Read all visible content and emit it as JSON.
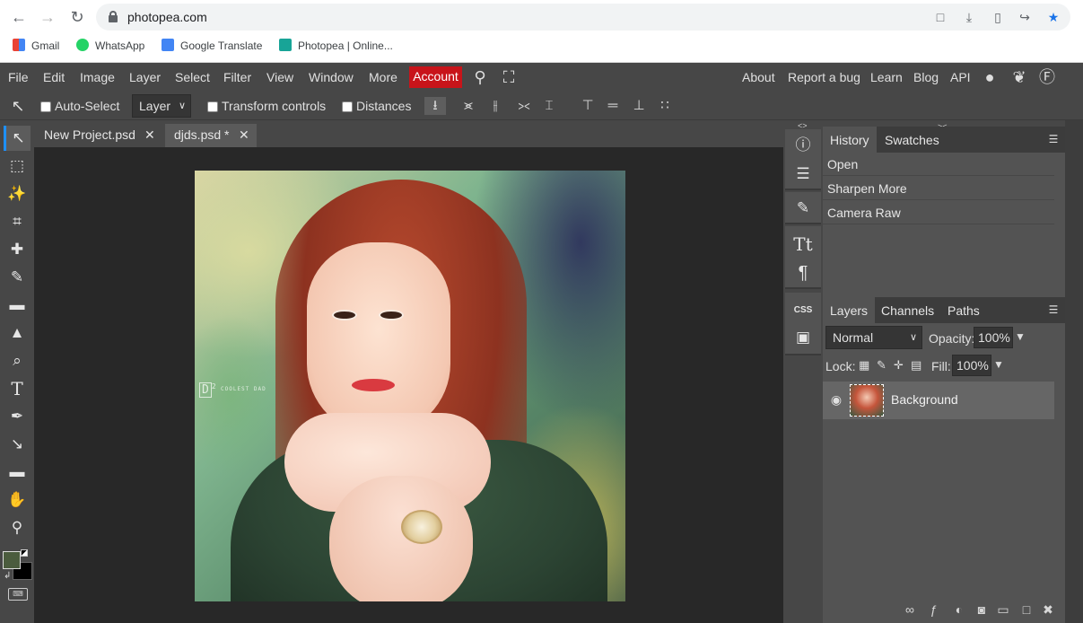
{
  "browser": {
    "url": "photopea.com",
    "bookmarks": [
      "Gmail",
      "WhatsApp",
      "Google Translate",
      "Photopea | Online..."
    ]
  },
  "menu": {
    "items": [
      "File",
      "Edit",
      "Image",
      "Layer",
      "Select",
      "Filter",
      "View",
      "Window",
      "More"
    ],
    "account": "Account",
    "right_links": [
      "About",
      "Report a bug",
      "Learn",
      "Blog",
      "API"
    ]
  },
  "options": {
    "auto_select": "Auto-Select",
    "layer_select": "Layer",
    "transform_controls": "Transform controls",
    "distances": "Distances"
  },
  "tabs": [
    {
      "label": "New Project.psd"
    },
    {
      "label": "djds.psd *"
    }
  ],
  "canvas": {
    "watermark": "D",
    "watermark_sup": "2",
    "watermark_small": "COOLEST DAD"
  },
  "history": {
    "tabs": [
      "History",
      "Swatches"
    ],
    "steps": [
      "Open",
      "Sharpen More",
      "Camera Raw"
    ]
  },
  "layers": {
    "tabs": [
      "Layers",
      "Channels",
      "Paths"
    ],
    "blend_mode": "Normal",
    "opacity_label": "Opacity:",
    "opacity_value": "100%",
    "lock_label": "Lock:",
    "fill_label": "Fill:",
    "fill_value": "100%",
    "items": [
      {
        "name": "Background"
      }
    ]
  },
  "colors": {
    "foreground": "#4b5c3e",
    "background": "#000000",
    "accent": "#c8141a"
  }
}
